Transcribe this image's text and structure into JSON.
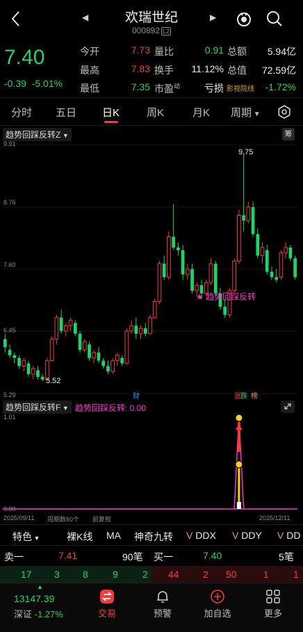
{
  "header": {
    "title": "欢瑞世纪",
    "code": "000892",
    "code_tag": "L2"
  },
  "quote": {
    "price": "7.40",
    "change": "-0.39",
    "change_pct": "-5.01%",
    "rows": [
      {
        "l1": "今开",
        "v1": "7.73",
        "l2": "量比",
        "v2": "0.91",
        "l3": "总额",
        "v3": "5.94亿"
      },
      {
        "l1": "最高",
        "v1": "7.83",
        "l2": "换手",
        "v2": "11.12%",
        "l3": "总值",
        "v3": "72.59亿"
      },
      {
        "l1": "最低",
        "v1": "7.35",
        "l2": "市盈",
        "l2_sup": "动",
        "v2": "亏损",
        "l3": "影视院线",
        "v3": "-1.72%"
      }
    ]
  },
  "tabs": [
    "分时",
    "五日",
    "日K",
    "周K",
    "月K",
    "周期"
  ],
  "chip_label": "筹",
  "main_indicator": {
    "name": "趋势回踩反转Z",
    "signal_label": "★ 趋势回踩反转"
  },
  "axis": {
    "y_top": "9.91",
    "y_mid1": "8.76",
    "y_mid2": "7.60",
    "y_mid3": "6.45",
    "y_bot": "5.29",
    "high_label": "9.75",
    "low_label": "5.52"
  },
  "markers": {
    "cai": "财",
    "zhang": "涨",
    "die": "跌",
    "bang": "榜"
  },
  "sub_indicator": {
    "name": "趋势回踩反转F",
    "value_text": "趋势回踩反转: 0.00",
    "y_top": "1.01",
    "y_bot": "0.00",
    "date_start": "2025/09/11",
    "period_text": "周期数60个",
    "adjust_text": "前复权",
    "date_end": "2025/12/11"
  },
  "functions": [
    "特色",
    "裸K线",
    "MA",
    "神奇九转",
    "DDX",
    "DDY",
    "DD"
  ],
  "orderbook": {
    "sell1_label": "卖一",
    "sell1_price": "7.41",
    "sell1_vol": "90笔",
    "buy1_label": "买一",
    "buy1_price": "7.40",
    "buy1_vol": "5笔",
    "sell_queue": [
      "17",
      "3",
      "8",
      "9",
      "2"
    ],
    "buy_queue": [
      "44",
      "2",
      "50",
      "1",
      "1"
    ]
  },
  "nav": {
    "index_value": "13147.39",
    "index_name": "深证",
    "index_pct": "-1.27%",
    "items": [
      "交易",
      "预警",
      "加自选",
      "更多"
    ]
  },
  "colors": {
    "up": "#f23b3b",
    "down": "#1fd36a",
    "accent": "#e0a020",
    "signal": "#ff2fd0"
  },
  "chart_data": {
    "type": "candlestick",
    "y_range": [
      5.29,
      9.91
    ],
    "x_range": [
      "2025/09/11",
      "2025/12/11"
    ],
    "candles_ohlc": [
      [
        6.3,
        6.4,
        6.05,
        6.15
      ],
      [
        6.1,
        6.2,
        5.95,
        6.0
      ],
      [
        6.0,
        6.05,
        5.85,
        5.95
      ],
      [
        5.95,
        6.0,
        5.75,
        5.8
      ],
      [
        5.8,
        5.95,
        5.7,
        5.9
      ],
      [
        5.85,
        5.9,
        5.6,
        5.65
      ],
      [
        5.65,
        5.8,
        5.55,
        5.75
      ],
      [
        5.72,
        5.8,
        5.55,
        5.6
      ],
      [
        5.6,
        5.65,
        5.52,
        5.55
      ],
      [
        5.55,
        5.95,
        5.55,
        5.9
      ],
      [
        5.9,
        6.35,
        5.88,
        6.3
      ],
      [
        6.3,
        6.75,
        6.2,
        6.7
      ],
      [
        6.7,
        6.85,
        6.4,
        6.45
      ],
      [
        6.45,
        6.6,
        6.35,
        6.55
      ],
      [
        6.55,
        6.7,
        6.45,
        6.65
      ],
      [
        6.6,
        6.65,
        6.35,
        6.4
      ],
      [
        6.4,
        6.45,
        6.05,
        6.1
      ],
      [
        6.1,
        6.3,
        6.05,
        6.25
      ],
      [
        6.2,
        6.25,
        5.9,
        5.95
      ],
      [
        5.95,
        6.1,
        5.85,
        6.05
      ],
      [
        6.05,
        6.15,
        5.85,
        5.9
      ],
      [
        5.9,
        5.95,
        5.75,
        5.8
      ],
      [
        5.8,
        5.9,
        5.65,
        5.7
      ],
      [
        5.7,
        5.95,
        5.65,
        5.9
      ],
      [
        5.9,
        6.05,
        5.8,
        6.0
      ],
      [
        5.95,
        6.0,
        5.8,
        5.85
      ],
      [
        5.85,
        6.5,
        5.83,
        6.45
      ],
      [
        6.45,
        6.65,
        6.4,
        6.55
      ],
      [
        6.55,
        6.7,
        6.3,
        6.4
      ],
      [
        6.4,
        6.55,
        6.3,
        6.5
      ],
      [
        6.5,
        6.6,
        6.35,
        6.4
      ],
      [
        6.4,
        6.75,
        6.38,
        6.7
      ],
      [
        6.7,
        7.05,
        6.68,
        7.0
      ],
      [
        7.0,
        7.75,
        6.95,
        7.7
      ],
      [
        7.7,
        7.85,
        7.4,
        7.45
      ],
      [
        7.45,
        8.3,
        7.4,
        8.2
      ],
      [
        8.2,
        8.8,
        7.95,
        8.0
      ],
      [
        8.0,
        8.1,
        7.85,
        7.95
      ],
      [
        7.95,
        8.05,
        7.4,
        7.5
      ],
      [
        7.5,
        7.7,
        7.4,
        7.6
      ],
      [
        7.6,
        7.7,
        7.15,
        7.2
      ],
      [
        7.2,
        7.35,
        7.1,
        7.3
      ],
      [
        7.3,
        7.4,
        7.05,
        7.15
      ],
      [
        7.15,
        7.4,
        7.1,
        7.35
      ],
      [
        7.35,
        7.8,
        7.3,
        7.7
      ],
      [
        7.7,
        7.75,
        7.1,
        7.15
      ],
      [
        7.15,
        7.25,
        6.85,
        6.9
      ],
      [
        6.9,
        7.05,
        6.7,
        6.75
      ],
      [
        6.75,
        7.25,
        6.7,
        7.2
      ],
      [
        7.2,
        7.8,
        7.15,
        7.75
      ],
      [
        7.75,
        8.7,
        7.7,
        8.6
      ],
      [
        8.6,
        9.75,
        8.3,
        8.5
      ],
      [
        8.5,
        8.85,
        8.45,
        8.75
      ],
      [
        8.75,
        8.85,
        8.2,
        8.25
      ],
      [
        8.25,
        8.35,
        7.8,
        7.85
      ],
      [
        7.85,
        8.1,
        7.7,
        8.0
      ],
      [
        7.95,
        8.05,
        7.5,
        7.55
      ],
      [
        7.55,
        7.65,
        7.4,
        7.45
      ],
      [
        7.45,
        7.6,
        7.35,
        7.4
      ],
      [
        7.45,
        7.95,
        7.4,
        7.9
      ],
      [
        7.9,
        8.1,
        7.8,
        8.0
      ],
      [
        8.0,
        8.05,
        7.75,
        7.8
      ],
      [
        7.8,
        7.85,
        7.4,
        7.45
      ]
    ],
    "sub_series": {
      "name": "趋势回踩反转",
      "values_nonzero_index": [
        50
      ],
      "peak_value": 1.01
    }
  }
}
